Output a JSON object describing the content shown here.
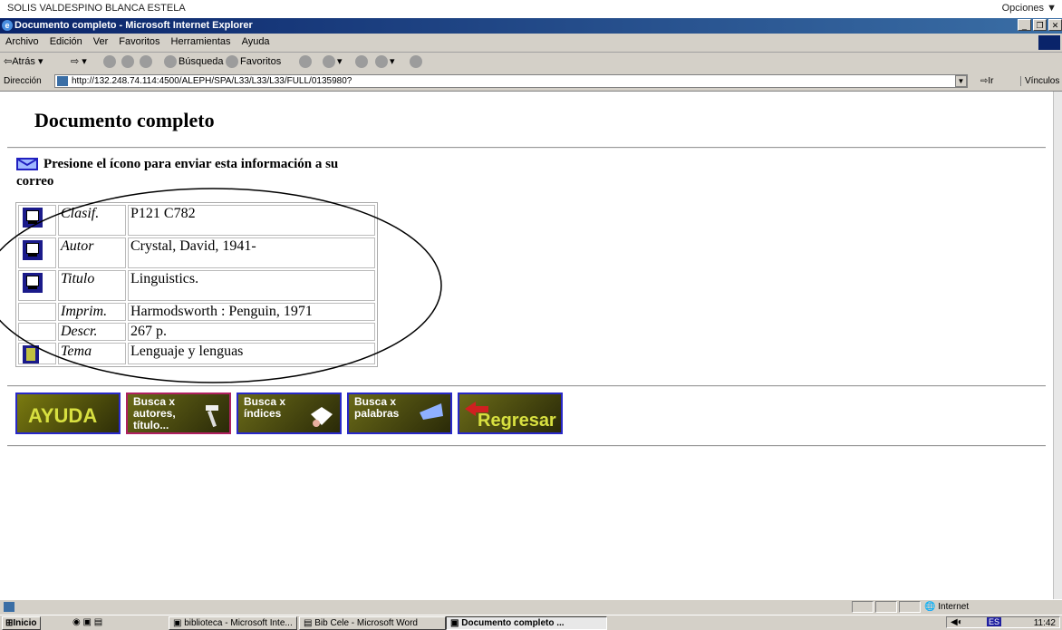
{
  "userbar": {
    "name": "SOLIS VALDESPINO BLANCA ESTELA",
    "options": "Opciones ▼"
  },
  "window": {
    "title": "Documento completo - Microsoft Internet Explorer"
  },
  "menu": {
    "items": [
      "Archivo",
      "Edición",
      "Ver",
      "Favoritos",
      "Herramientas",
      "Ayuda"
    ]
  },
  "toolbar": {
    "back": "⇦Atrás",
    "search": "Búsqueda",
    "favorites": "Favoritos"
  },
  "address": {
    "label": "Dirección",
    "url": "http://132.248.74.114:4500/ALEPH/SPA/L33/L33/L33/FULL/0135980?",
    "go": "Ir",
    "links": "Vínculos"
  },
  "page": {
    "title": "Documento completo",
    "mail_message": "Presione el ícono para enviar esta información a su correo",
    "record": [
      {
        "field": "Clasif.",
        "value": "P121 C782",
        "icon": "computer-icon"
      },
      {
        "field": "Autor",
        "value": "Crystal, David, 1941-",
        "icon": "computer-icon"
      },
      {
        "field": "Titulo",
        "value": "Linguistics.",
        "icon": "computer-icon"
      },
      {
        "field": "Imprim.",
        "value": "Harmodsworth : Penguin, 1971",
        "icon": ""
      },
      {
        "field": "Descr.",
        "value": "267 p.",
        "icon": ""
      },
      {
        "field": "Tema",
        "value": "Lenguaje y lenguas",
        "icon": "document-icon"
      }
    ],
    "buttons": {
      "help": "AYUDA",
      "search_authors": "Busca x autores, título...",
      "search_indexes": "Busca x índices",
      "search_words": "Busca x palabras",
      "back": "Regresar"
    }
  },
  "status": {
    "zone": "Internet"
  },
  "taskbar": {
    "start": "Inicio",
    "tasks": [
      "biblioteca - Microsoft Inte...",
      "Bib Cele - Microsoft Word",
      "Documento completo ..."
    ],
    "lang": "ES",
    "clock": "11:42"
  },
  "colors": {
    "titlebar": "#0a246a",
    "button_border": "#2828c8",
    "button_bg": "#5a5a1a"
  }
}
